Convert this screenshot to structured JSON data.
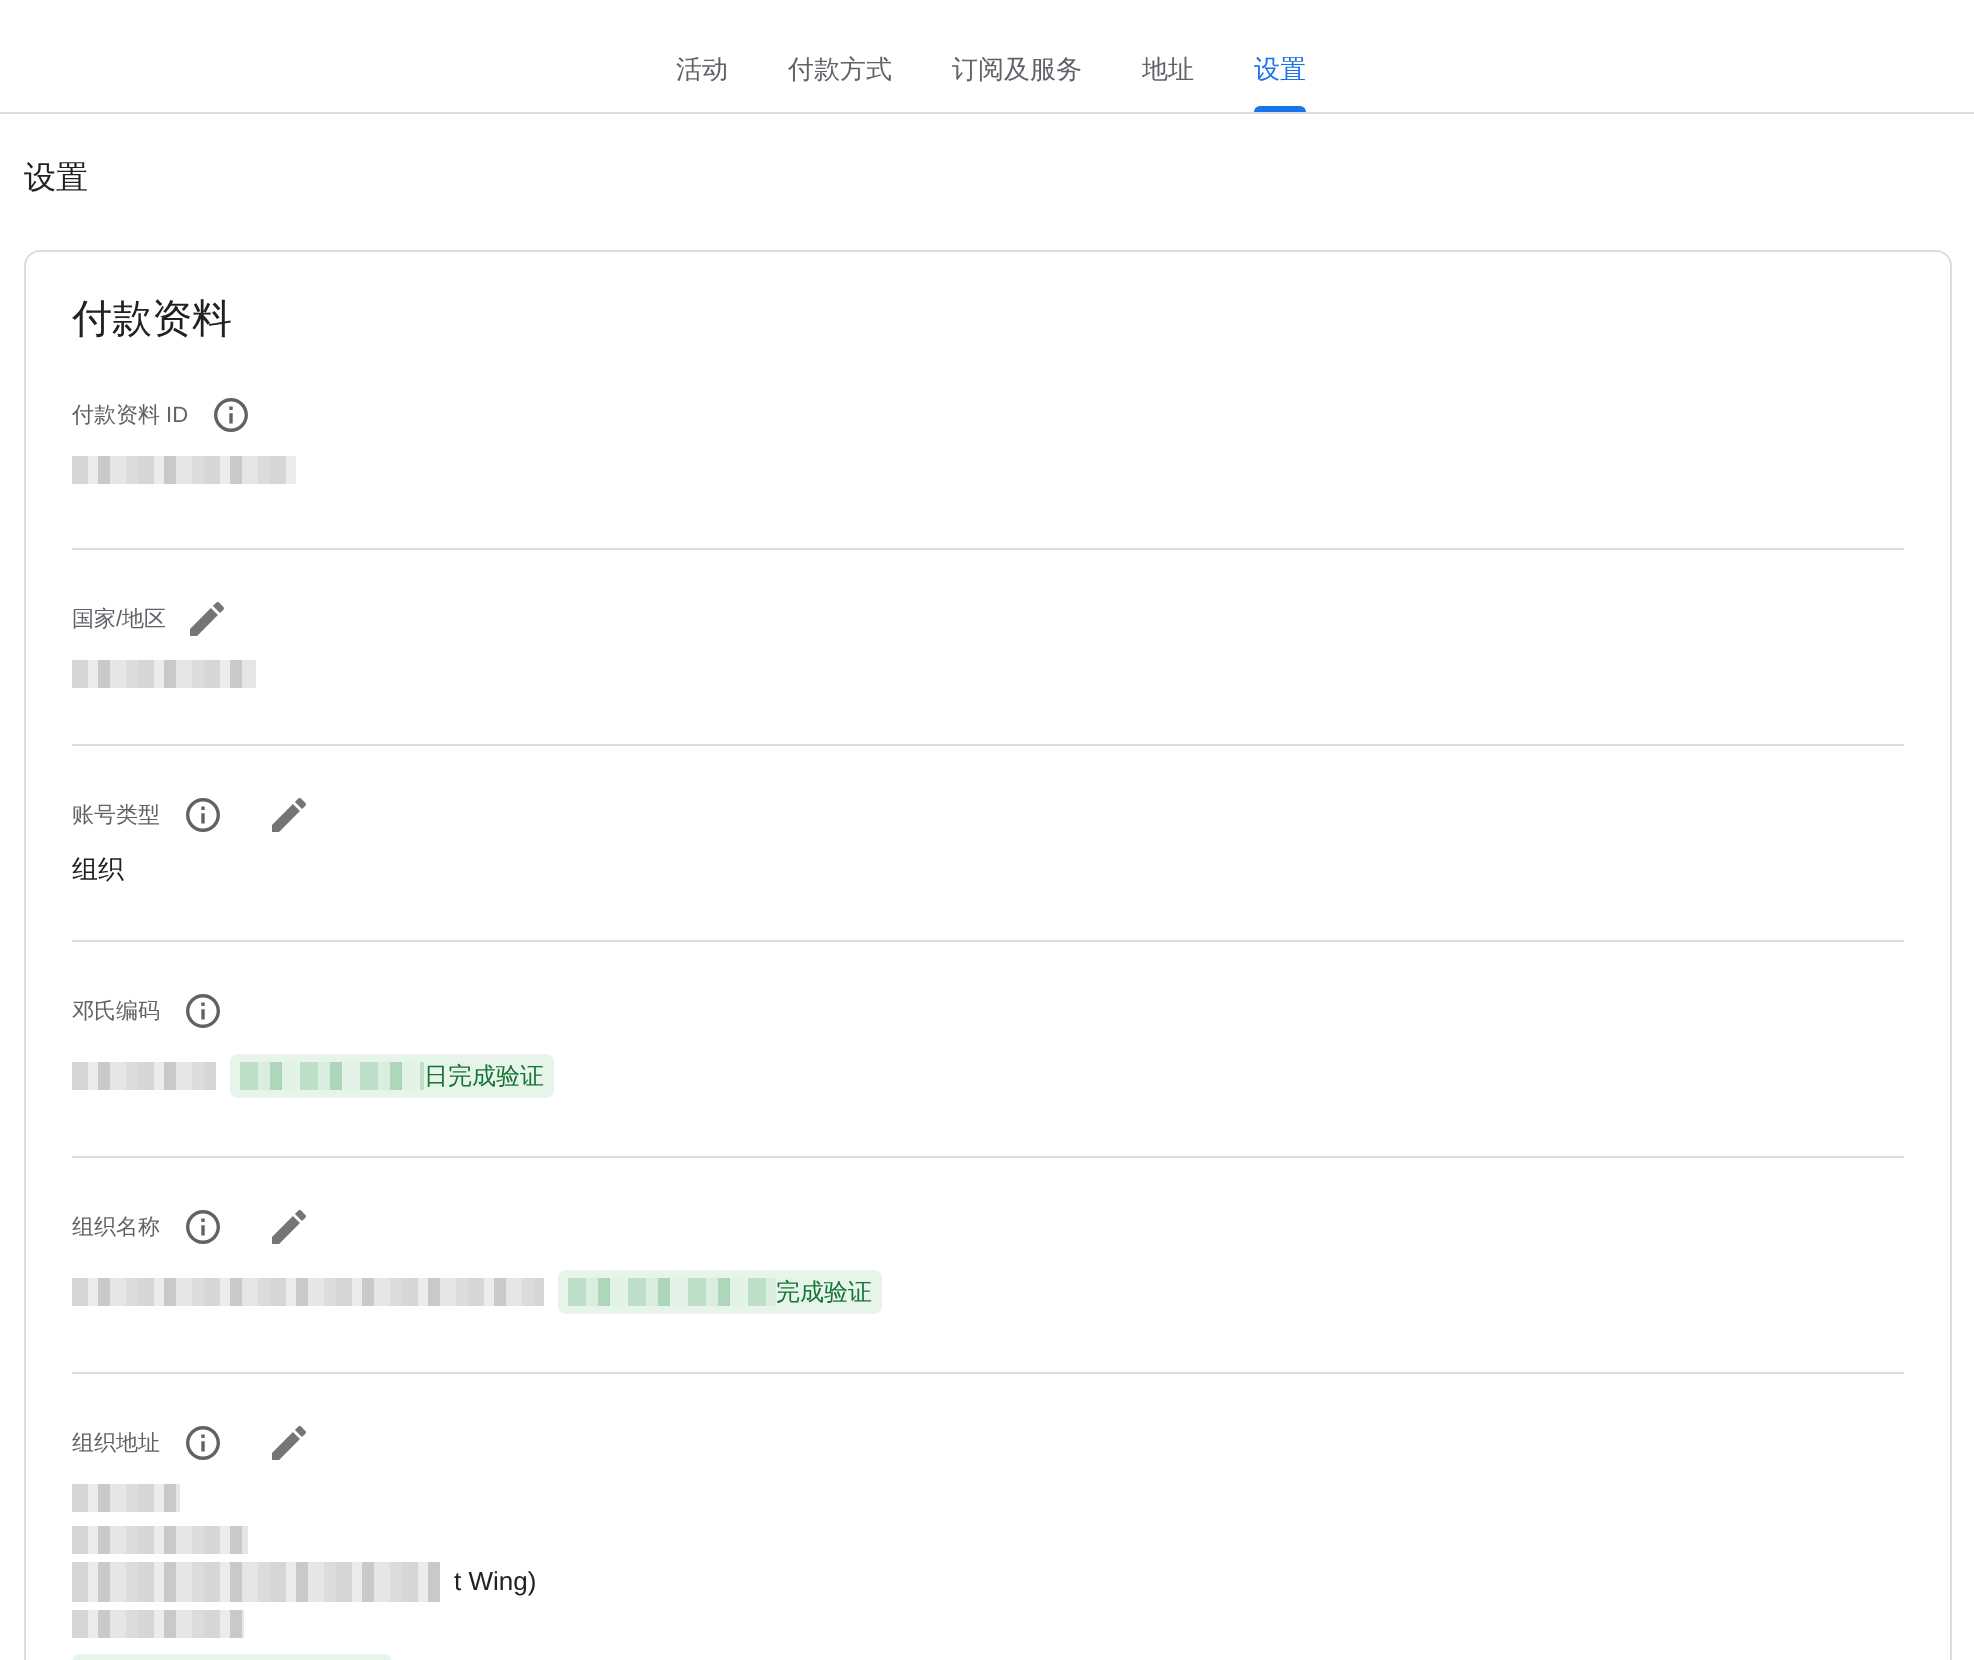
{
  "tabs": [
    {
      "label": "活动",
      "selected": false
    },
    {
      "label": "付款方式",
      "selected": false
    },
    {
      "label": "订阅及服务",
      "selected": false
    },
    {
      "label": "地址",
      "selected": false
    },
    {
      "label": "设置",
      "selected": true
    }
  ],
  "page_title": "设置",
  "card": {
    "title": "付款资料",
    "fields": [
      {
        "label": "付款资料 ID",
        "info": true,
        "editable": false,
        "lines": [
          [
            {
              "kind": "redacted"
            }
          ]
        ]
      },
      {
        "label": "国家/地区",
        "info": false,
        "editable": true,
        "lines": [
          [
            {
              "kind": "redacted"
            }
          ]
        ]
      },
      {
        "label": "账号类型",
        "info": true,
        "editable": true,
        "lines": [
          [
            {
              "kind": "text",
              "text": "组织"
            }
          ]
        ]
      },
      {
        "label": "邓氏编码",
        "info": true,
        "editable": false,
        "lines": [
          [
            {
              "kind": "redacted"
            },
            {
              "kind": "badge",
              "text": "日完成验证"
            }
          ]
        ]
      },
      {
        "label": "组织名称",
        "info": true,
        "editable": true,
        "lines": [
          [
            {
              "kind": "redacted"
            },
            {
              "kind": "badge",
              "text": "完成验证"
            }
          ]
        ]
      },
      {
        "label": "组织地址",
        "info": true,
        "editable": true,
        "lines": [
          [
            {
              "kind": "redacted"
            }
          ],
          [
            {
              "kind": "redacted"
            }
          ],
          [
            {
              "kind": "redacted"
            },
            {
              "kind": "text",
              "text": "t Wing)"
            }
          ],
          [
            {
              "kind": "redacted"
            }
          ],
          [
            {
              "kind": "badge"
            }
          ]
        ]
      }
    ]
  }
}
